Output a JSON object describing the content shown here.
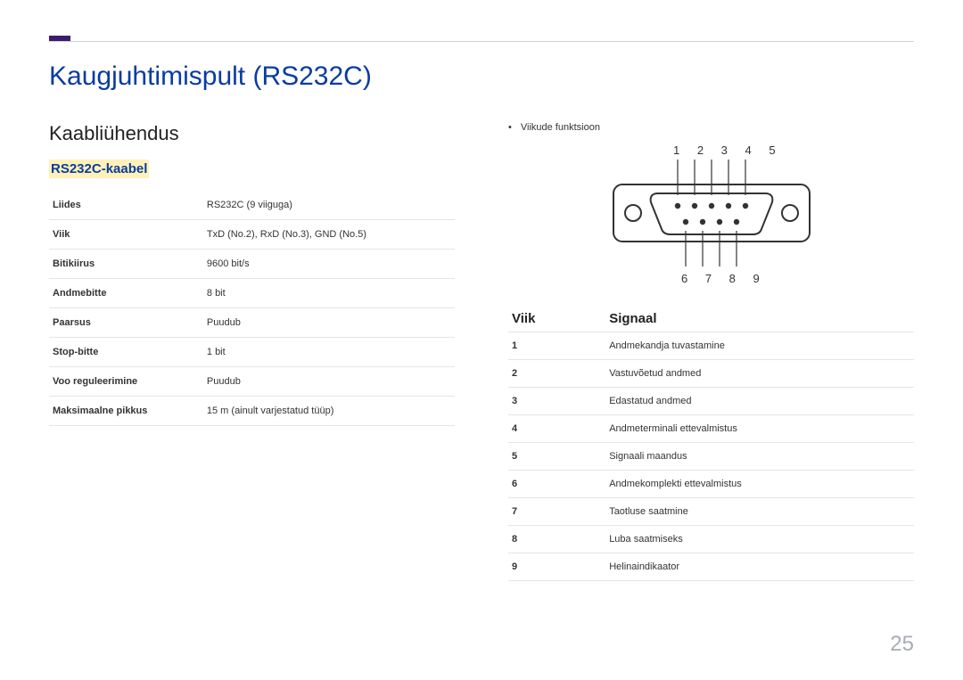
{
  "title": "Kaugjuhtimispult (RS232C)",
  "section": "Kaabliühendus",
  "subsection": "RS232C-kaabel",
  "specs": [
    {
      "k": "Liides",
      "v": "RS232C (9 viiguga)"
    },
    {
      "k": "Viik",
      "v": "TxD (No.2), RxD (No.3), GND (No.5)"
    },
    {
      "k": "Bitikiirus",
      "v": "9600 bit/s"
    },
    {
      "k": "Andmebitte",
      "v": "8 bit"
    },
    {
      "k": "Paarsus",
      "v": "Puudub"
    },
    {
      "k": "Stop-bitte",
      "v": "1 bit"
    },
    {
      "k": "Voo reguleerimine",
      "v": "Puudub"
    },
    {
      "k": "Maksimaalne pikkus",
      "v": "15 m (ainult varjestatud tüüp)"
    }
  ],
  "pin_function_label": "Viikude funktsioon",
  "pin_top": "1  2  3  4  5",
  "pin_bottom": "6  7  8  9",
  "sig_head_pin": "Viik",
  "sig_head_sig": "Signaal",
  "signals": [
    {
      "n": "1",
      "s": "Andmekandja tuvastamine"
    },
    {
      "n": "2",
      "s": "Vastuvõetud andmed"
    },
    {
      "n": "3",
      "s": "Edastatud andmed"
    },
    {
      "n": "4",
      "s": "Andmeterminali ettevalmistus"
    },
    {
      "n": "5",
      "s": "Signaali maandus"
    },
    {
      "n": "6",
      "s": "Andmekomplekti ettevalmistus"
    },
    {
      "n": "7",
      "s": "Taotluse saatmine"
    },
    {
      "n": "8",
      "s": "Luba saatmiseks"
    },
    {
      "n": "9",
      "s": "Helinaindikaator"
    }
  ],
  "page_number": "25"
}
